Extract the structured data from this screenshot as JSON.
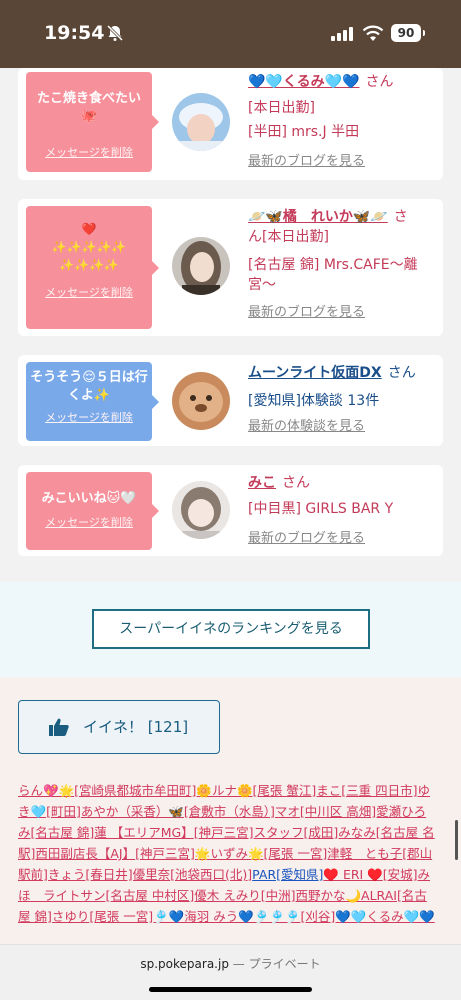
{
  "status": {
    "time": "19:54",
    "battery": "90"
  },
  "cards": [
    {
      "message": "たこ焼き食べたい🐙",
      "delete_label": "メッセージを削除",
      "name": "💙🩵くるみ🩵💙",
      "san": "さん",
      "line1": "[本日出勤]",
      "line2": "[半田] mrs.J 半田",
      "link": "最新のブログを見る",
      "theme": "pink"
    },
    {
      "message": "❤️\n✨✨✨✨✨\n✨✨✨✨",
      "delete_label": "メッセージを削除",
      "name": "🪐🦋橘　れいか🦋🪐",
      "san": "さ",
      "line1": "ん[本日出勤]",
      "line2": "[名古屋 錦] Mrs.CAFE〜離宮〜",
      "link": "最新のブログを見る",
      "theme": "pink"
    },
    {
      "message": "そうそう😌５日は行くよ✨",
      "delete_label": "メッセージを削除",
      "name": "ムーンライト仮面DX",
      "san": "さん",
      "line1": "[愛知県]体験談 13件",
      "line2": "",
      "link": "最新の体験談を見る",
      "theme": "blue"
    },
    {
      "message": "みこいいね🐱🤍",
      "delete_label": "メッセージを削除",
      "name": "みこ",
      "san": "さん",
      "line1": "[中目黒] GIRLS BAR Y",
      "line2": "",
      "link": "最新のブログを見る",
      "theme": "pink"
    }
  ],
  "ranking_button": "スーパーイイネのランキングを見る",
  "like_button": "イイネ！ [121]",
  "ticker": [
    "らん💖🌟",
    "[宮崎県都城市牟田町]🌼ルナ🌼",
    "[尾張 蟹江]まこ",
    "[三重 四日市]ゆき🩵",
    "[町田]あやか（采香）🦋",
    "[倉敷市（水島）]マオ",
    "[中川区 高畑]愛瀬ひろみ",
    "[名古屋 錦]蓮 【エリアMG】",
    "[神戸三宮]スタッフ",
    "[成田]みなみ",
    "[名古屋 名駅]西田副店長【AJ】",
    "[神戸三宮]🌟いずみ🌟",
    "[尾張 一宮]津軽　とも子",
    "[郡山駅前]きょう",
    "[春日井]優里奈",
    "[池袋西口(北)]",
    "PAR[愛知県]",
    "♥️ ERI ♥️",
    "[安城]みほ　ライトサン",
    "[名古屋 中村区]優木 えみり",
    "[中洲]西野かな🌙ALRAI",
    "[名古屋 錦]さゆり",
    "[尾張 一宮]🎐💙海羽 みう💙🎐🎐🎐",
    "[刈谷]💙🩵くるみ🩵💙"
  ],
  "url_bar": {
    "domain": "sp.pokepara.jp",
    "privacy": "— プライベート"
  },
  "colors": {
    "status_bg": "#5a4636",
    "pink": "#f6919c",
    "blue": "#7aa9ea",
    "name_pink": "#c43b59",
    "name_blue": "#1a4e8a"
  }
}
